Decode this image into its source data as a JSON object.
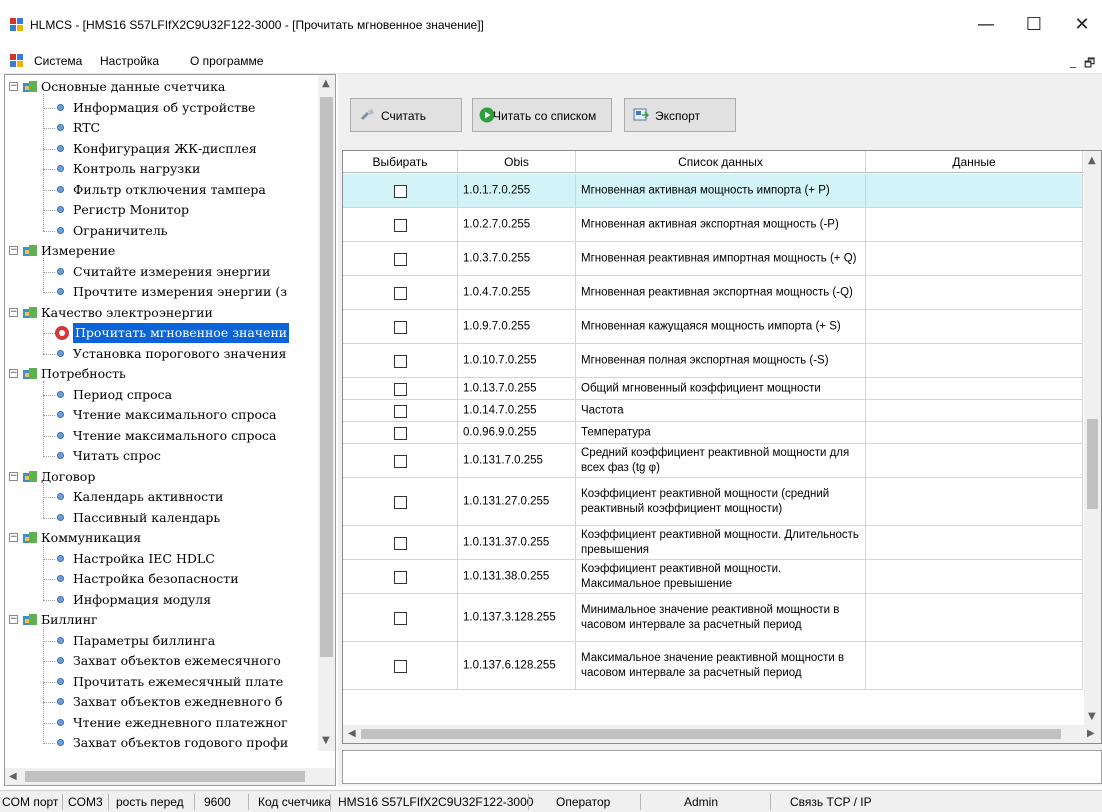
{
  "window": {
    "title": "HLMCS - [HMS16 S57LFIfX2C9U32F122-3000 - [Прочитать мгновенное значение]]",
    "minimize": "—",
    "maximize": "☐",
    "close": "✕"
  },
  "menu": {
    "items": [
      "Система",
      "Настройка",
      "О программе"
    ],
    "mdi_minimize": "_",
    "mdi_restore": "🗗"
  },
  "tree": {
    "groups": [
      {
        "label": "Основные данные счетчика",
        "children": [
          "Информация об устройстве",
          "RTC",
          "Конфигурация ЖК-дисплея",
          "Контроль нагрузки",
          "Фильтр отключения тампера",
          "Регистр Монитор",
          "Ограничитель"
        ]
      },
      {
        "label": "Измерение",
        "children": [
          "Считайте измерения энергии",
          "Прочтите измерения энергии (з"
        ]
      },
      {
        "label": "Качество электроэнергии",
        "children": [
          "Прочитать мгновенное значени",
          "Установка порогового значения"
        ]
      },
      {
        "label": "Потребность",
        "children": [
          "Период спроса",
          "Чтение максимального спроса",
          "Чтение максимального спроса",
          "Читать спрос"
        ]
      },
      {
        "label": "Договор",
        "children": [
          "Календарь активности",
          "Пассивный календарь"
        ]
      },
      {
        "label": "Коммуникация",
        "children": [
          "Настройка IEC HDLC",
          "Настройка безопасности",
          "Информация модуля"
        ]
      },
      {
        "label": "Биллинг",
        "children": [
          "Параметры биллинга",
          "Захват объектов ежемесячного",
          "Прочитать ежемесячный плате",
          "Захват объектов ежедневного б",
          "Чтение ежедневного платежног",
          "Захват объектов годового профи"
        ]
      }
    ],
    "selected": "Прочитать мгновенное значени"
  },
  "toolbar": {
    "read_label": "Считать",
    "read_list_label": "Читать со списком",
    "export_label": "Экспорт"
  },
  "table": {
    "columns": [
      "Выбирать",
      "Obis",
      "Список данных",
      "Данные"
    ],
    "rows": [
      {
        "obis": "1.0.1.7.0.255",
        "name": "Мгновенная активная мощность импорта (+ P)",
        "value": "",
        "checked": false,
        "highlighted": true
      },
      {
        "obis": "1.0.2.7.0.255",
        "name": "Мгновенная активная экспортная мощность (-P)",
        "value": "",
        "checked": false
      },
      {
        "obis": "1.0.3.7.0.255",
        "name": "Мгновенная реактивная импортная мощность (+ Q)",
        "value": "",
        "checked": false
      },
      {
        "obis": "1.0.4.7.0.255",
        "name": "Мгновенная реактивная экспортная мощность (-Q)",
        "value": "",
        "checked": false
      },
      {
        "obis": "1.0.9.7.0.255",
        "name": "Мгновенная кажущаяся мощность импорта (+ S)",
        "value": "",
        "checked": false
      },
      {
        "obis": "1.0.10.7.0.255",
        "name": "Мгновенная полная экспортная мощность (-S)",
        "value": "",
        "checked": false
      },
      {
        "obis": "1.0.13.7.0.255",
        "name": "Общий мгновенный коэффициент мощности",
        "value": "",
        "checked": false
      },
      {
        "obis": "1.0.14.7.0.255",
        "name": "Частота",
        "value": "",
        "checked": false
      },
      {
        "obis": "0.0.96.9.0.255",
        "name": "Температура",
        "value": "",
        "checked": false
      },
      {
        "obis": "1.0.131.7.0.255",
        "name": "Средний коэффициент реактивной мощности для всех фаз (tg φ)",
        "value": "",
        "checked": false
      },
      {
        "obis": "1.0.131.27.0.255",
        "name": "Коэффициент реактивной мощности (средний реактивный коэффициент мощности)",
        "value": "",
        "checked": false
      },
      {
        "obis": "1.0.131.37.0.255",
        "name": "Коэффициент реактивной мощности. Длительность превышения",
        "value": "",
        "checked": false
      },
      {
        "obis": "1.0.131.38.0.255",
        "name": "Коэффициент реактивной мощности. Максимальное превышение",
        "value": "",
        "checked": false
      },
      {
        "obis": "1.0.137.3.128.255",
        "name": "Минимальное значение реактивной мощности в часовом интервале за расчетный период",
        "value": "",
        "checked": false
      },
      {
        "obis": "1.0.137.6.128.255",
        "name": "Максимальное значение реактивной мощности в часовом интервале за расчетный период",
        "value": "",
        "checked": false
      }
    ]
  },
  "status": {
    "com_port_label": "COM порт",
    "com_port_value": "COM3",
    "baud_label": "рость перед",
    "baud_value": "9600",
    "meter_code_label": "Код счетчика",
    "meter_code_value": "HMS16 S57LFIfX2C9U32F122-3000",
    "operator_label": "Оператор",
    "operator_value": "Admin",
    "link_label": "Связь TCP / IP"
  },
  "colors": {
    "selection": "#0a64d8",
    "row_highlight": "#d2f4f8"
  }
}
